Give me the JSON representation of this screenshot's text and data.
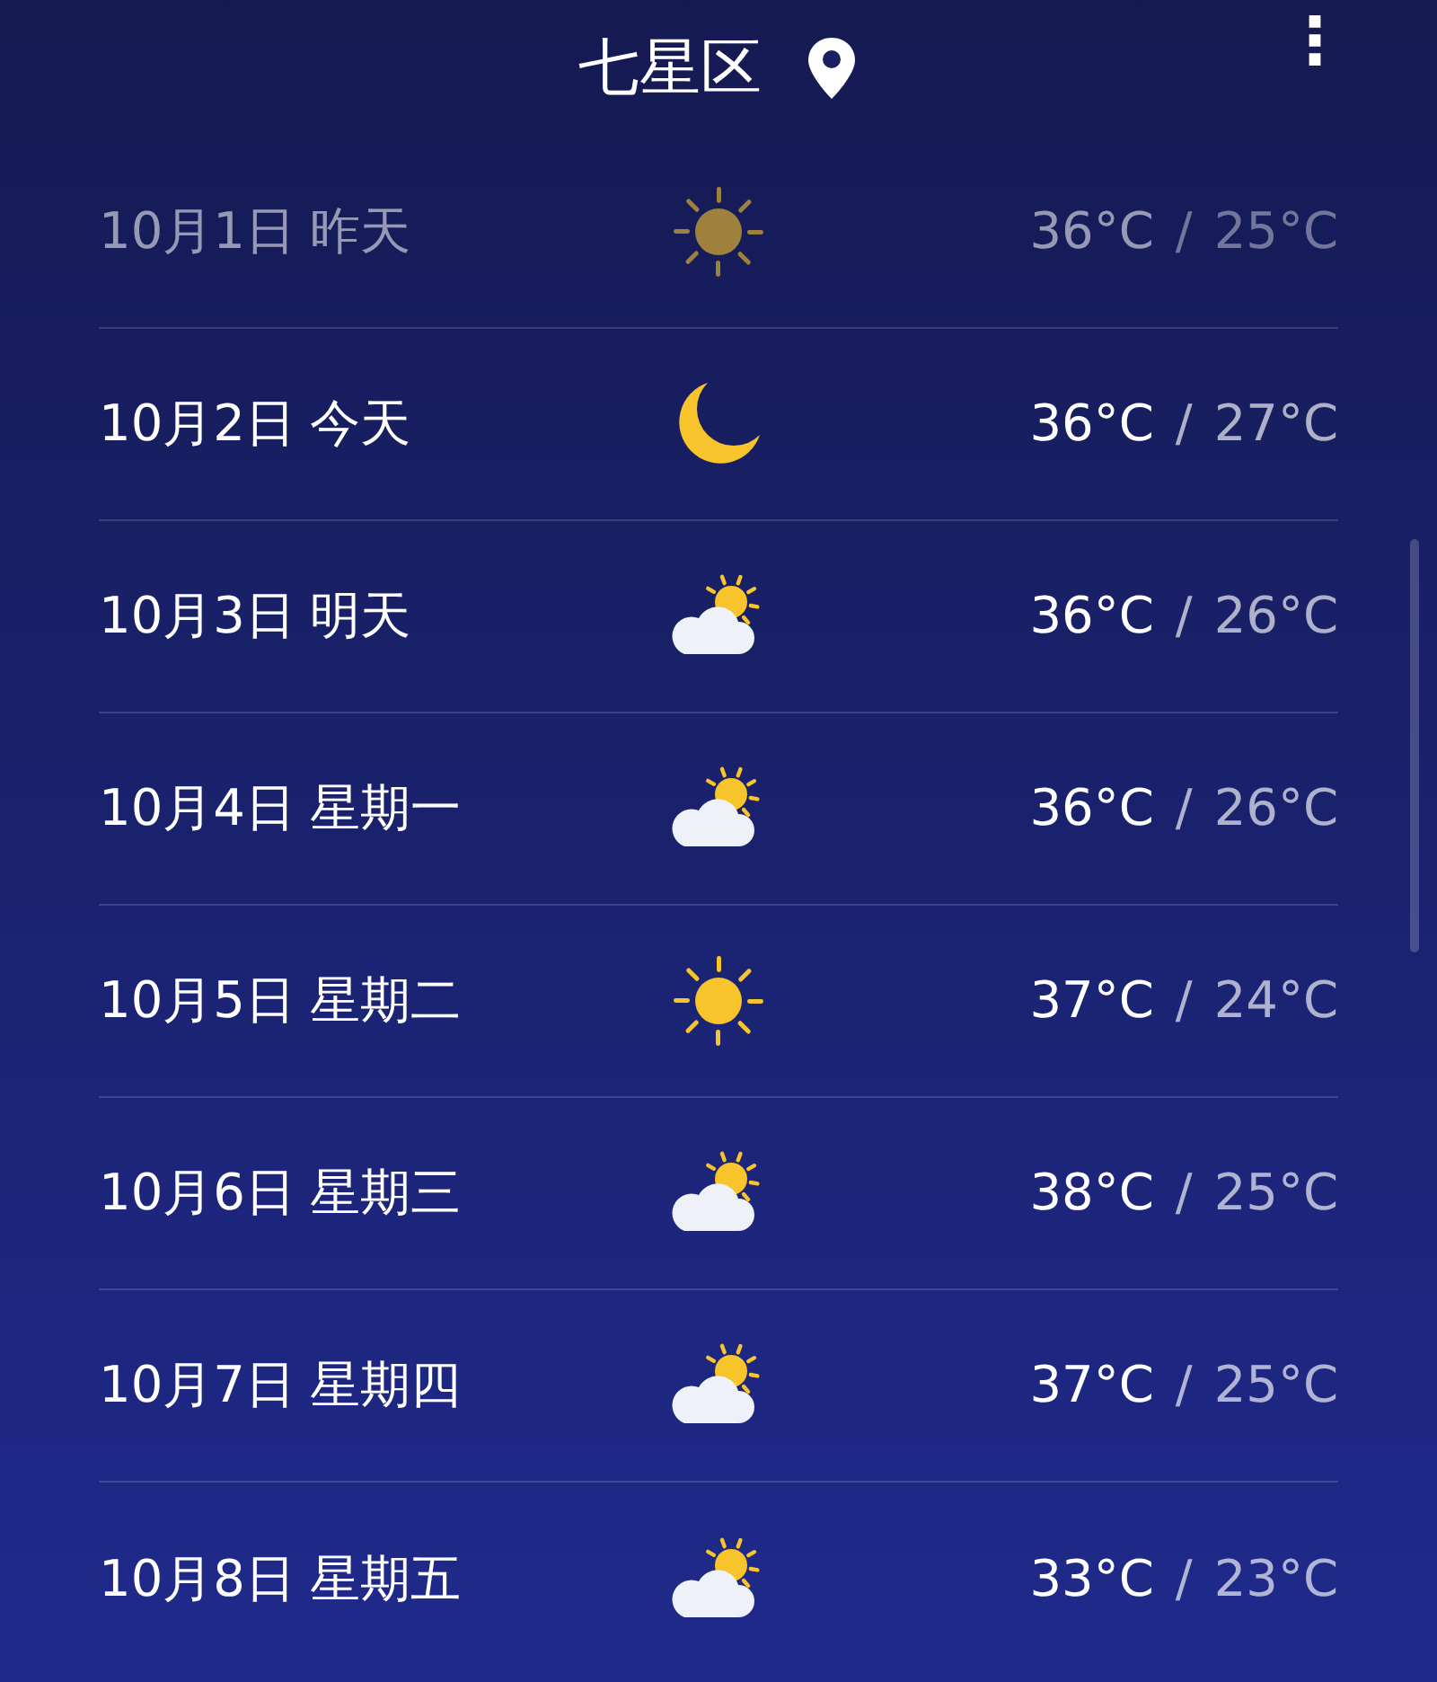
{
  "header": {
    "title": "七星区",
    "menu": "⋮"
  },
  "days": [
    {
      "date": "10月1日",
      "day": "昨天",
      "kind": "sun",
      "past": true,
      "high": "36°C",
      "separator": "/",
      "low": "25°C"
    },
    {
      "date": "10月2日",
      "day": "今天",
      "kind": "moon",
      "past": false,
      "high": "36°C",
      "separator": "/",
      "low": "27°C"
    },
    {
      "date": "10月3日",
      "day": "明天",
      "kind": "partly-cloudy",
      "past": false,
      "high": "36°C",
      "separator": "/",
      "low": "26°C"
    },
    {
      "date": "10月4日",
      "day": "星期一",
      "kind": "partly-cloudy",
      "past": false,
      "high": "36°C",
      "separator": "/",
      "low": "26°C"
    },
    {
      "date": "10月5日",
      "day": "星期二",
      "kind": "sun",
      "past": false,
      "high": "37°C",
      "separator": "/",
      "low": "24°C"
    },
    {
      "date": "10月6日",
      "day": "星期三",
      "kind": "partly-cloudy",
      "past": false,
      "high": "38°C",
      "separator": "/",
      "low": "25°C"
    },
    {
      "date": "10月7日",
      "day": "星期四",
      "kind": "partly-cloudy",
      "past": false,
      "high": "37°C",
      "separator": "/",
      "low": "25°C"
    },
    {
      "date": "10月8日",
      "day": "星期五",
      "kind": "partly-cloudy",
      "past": false,
      "high": "33°C",
      "separator": "/",
      "low": "23°C"
    }
  ]
}
